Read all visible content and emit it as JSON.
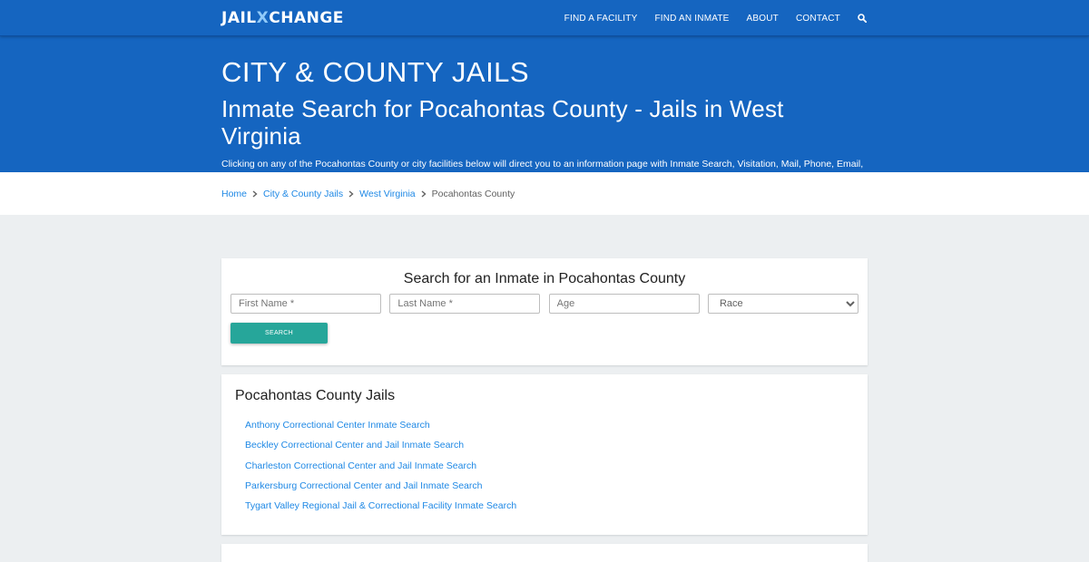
{
  "navbar": {
    "logo_a": "JAIL",
    "logo_b": "CHANGE",
    "logo_x": "X",
    "links": [
      "FIND A FACILITY",
      "FIND AN INMATE",
      "ABOUT",
      "CONTACT"
    ],
    "search_icon": "search-icon"
  },
  "hero": {
    "title": "CITY & COUNTY JAILS",
    "subtitle": "Inmate Search for Pocahontas County - Jails in West Virginia",
    "description": "Clicking on any of the Pocahontas County or city facilities below will direct you to an information page with Inmate Search, Visitation, Mail, Phone, Email, Court cases, Most Wanted, Recent Arrests, Bail/Bond and more."
  },
  "breadcrumb": {
    "items": [
      "Home",
      "City & County Jails",
      "West Virginia"
    ],
    "current": "Pocahontas County"
  },
  "search": {
    "title": "Search for an Inmate in Pocahontas County",
    "first_name_placeholder": "First Name *",
    "last_name_placeholder": "Last Name *",
    "age_placeholder": "Age",
    "race_selected": "Race",
    "button_label": "SEARCH"
  },
  "jails": {
    "title": "Pocahontas County Jails",
    "items": [
      "Anthony Correctional Center Inmate Search",
      "Beckley Correctional Center and Jail Inmate Search",
      "Charleston Correctional Center and Jail Inmate Search",
      "Parkersburg Correctional Center and Jail Inmate Search",
      "Tygart Valley Regional Jail & Correctional Facility Inmate Search"
    ]
  },
  "colors": {
    "primary": "#1565c0",
    "link": "#1e88e5",
    "button": "#26a69a",
    "background": "#eceff1"
  }
}
